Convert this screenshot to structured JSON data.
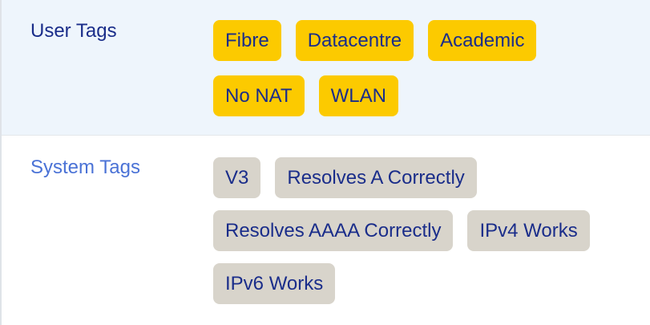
{
  "user_tags": {
    "label": "User Tags",
    "items": [
      "Fibre",
      "Datacentre",
      "Academic",
      "No NAT",
      "WLAN"
    ]
  },
  "system_tags": {
    "label": "System Tags",
    "items": [
      "V3",
      "Resolves A Correctly",
      "Resolves AAAA Correctly",
      "IPv4 Works",
      "IPv6 Works"
    ]
  },
  "colors": {
    "user_tag_bg": "#fcca00",
    "system_tag_bg": "#d8d4cb",
    "tag_text": "#1a2d8a",
    "user_label": "#1a2d8a",
    "system_label": "#4a72d6",
    "user_row_bg": "#eef5fc"
  }
}
